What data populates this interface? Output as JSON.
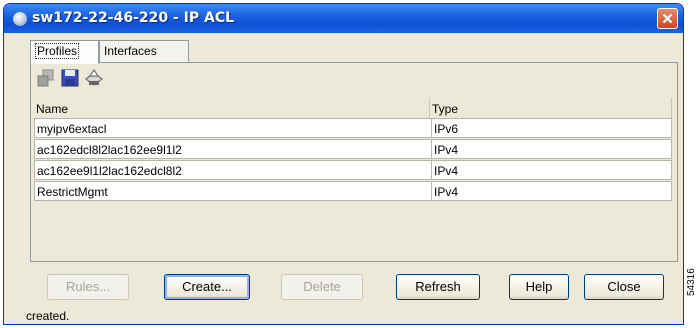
{
  "window": {
    "title": "sw172-22-46-220 - IP ACL"
  },
  "tabs": [
    {
      "label": "Profiles",
      "active": true
    },
    {
      "label": "Interfaces",
      "active": false
    }
  ],
  "toolbar": {
    "icons": [
      "copy-icon",
      "save-icon",
      "print-icon"
    ]
  },
  "table": {
    "columns": [
      "Name",
      "Type"
    ],
    "rows": [
      {
        "name": "myipv6extacl",
        "type": "IPv6"
      },
      {
        "name": "ac162edcl8l2lac162ee9l1l2",
        "type": "IPv4"
      },
      {
        "name": "ac162ee9l1l2lac162edcl8l2",
        "type": "IPv4"
      },
      {
        "name": "RestrictMgmt",
        "type": "IPv4"
      }
    ]
  },
  "buttons": {
    "rules": "Rules...",
    "create": "Create...",
    "delete": "Delete",
    "refresh": "Refresh",
    "help": "Help",
    "close": "Close"
  },
  "status": {
    "text": "created."
  },
  "side_tag": "54316",
  "colors": {
    "titlebar": "#0f50d4",
    "window_bg": "#ece9d8",
    "close_button": "#d5431d"
  }
}
